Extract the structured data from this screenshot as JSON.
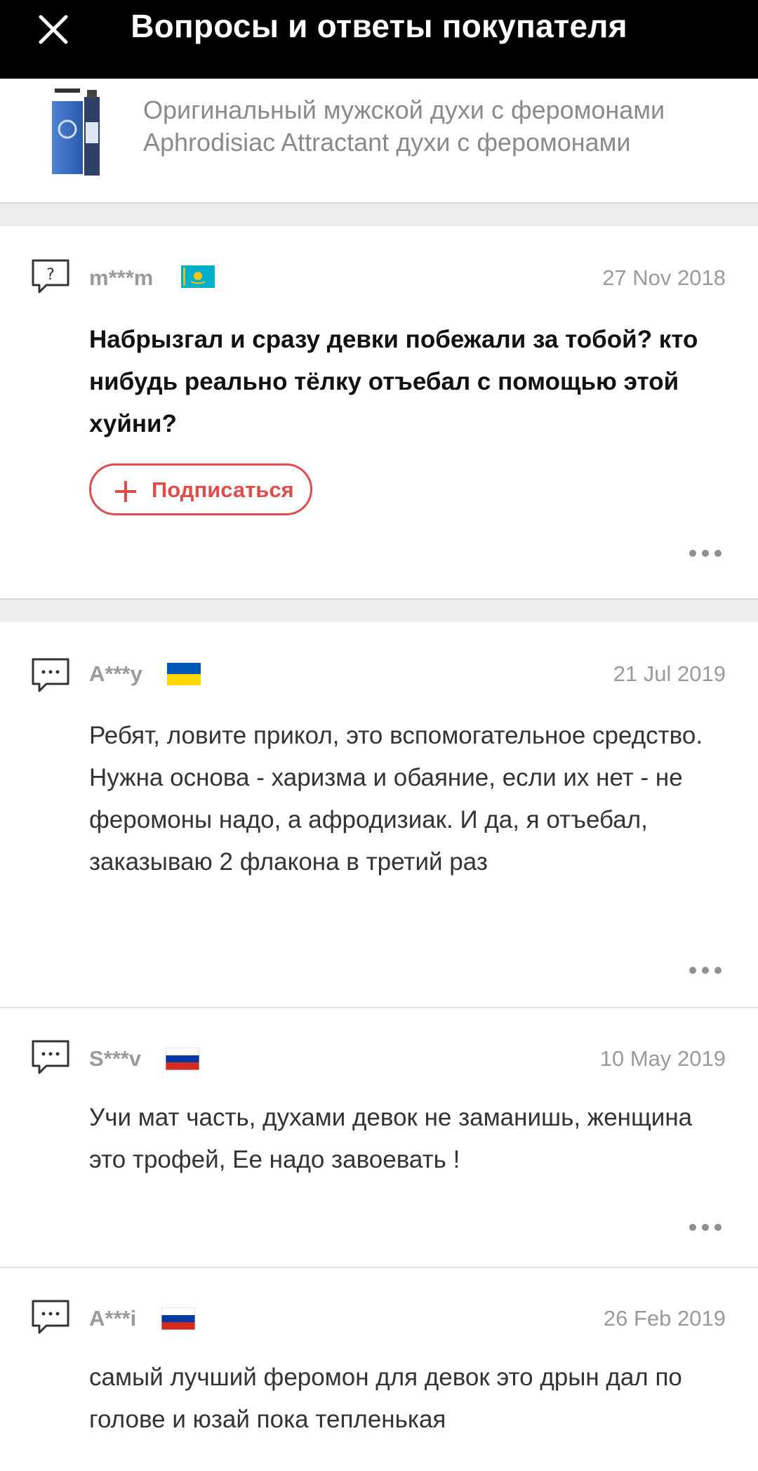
{
  "header": {
    "title": "Вопросы и ответы покупателя",
    "close_icon": "close-icon"
  },
  "product": {
    "name_line1": "Оригинальный мужской духи с феромонами",
    "name_line2": "Aphrodisiac Attractant духи с феромонами"
  },
  "question": {
    "user": "m***m",
    "flag": "kazakhstan-flag",
    "date": "27 Nov 2018",
    "text": "Набрызгал и сразу девки побежали за тобой? кто нибудь реально тёлку отъебал с помощью этой хуйни?",
    "subscribe_label": "Подписаться"
  },
  "answers": [
    {
      "user": "A***y",
      "flag": "ukraine-flag",
      "date": "21 Jul 2019",
      "text": "Ребят, ловите прикол, это вспомогательное средство.  Нужна основа - харизма и обаяние, если их нет - не феромоны надо, а афродизиак.  И да, я отъебал, заказываю 2 флакона в третий раз"
    },
    {
      "user": "S***v",
      "flag": "russia-flag",
      "date": "10 May 2019",
      "text": "Учи мат часть, духами девок не заманишь, женщина это трофей, Ее надо завоевать !"
    },
    {
      "user": "A***i",
      "flag": "russia-flag",
      "date": "26 Feb 2019",
      "text": "самый лучший феромон для девок это дрын дал по голове и юзай пока тепленькая"
    }
  ],
  "colors": {
    "header_bg": "#000000",
    "accent": "#e04b4b",
    "muted_text": "#9a9a9a",
    "separator": "#ededed"
  }
}
